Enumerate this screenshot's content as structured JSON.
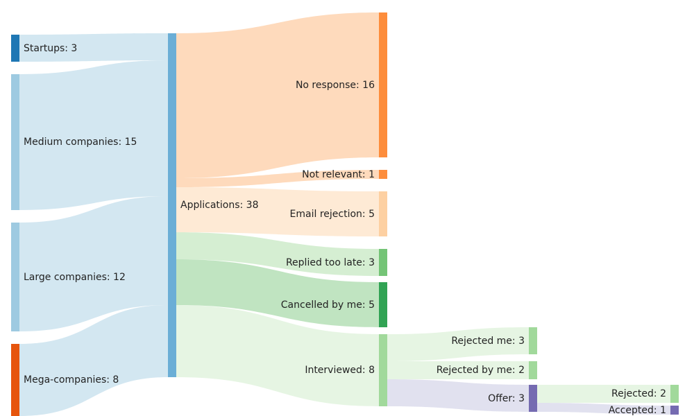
{
  "chart_data": {
    "type": "sankey",
    "title": "",
    "nodes": [
      {
        "id": "startups",
        "label": "Startups: 3",
        "value": 3,
        "color": "#1f77b4"
      },
      {
        "id": "medium",
        "label": "Medium companies: 15",
        "value": 15,
        "color": "#9ecae1"
      },
      {
        "id": "large",
        "label": "Large companies: 12",
        "value": 12,
        "color": "#9ecae1"
      },
      {
        "id": "mega",
        "label": "Mega-companies: 8",
        "value": 8,
        "color": "#e6550d"
      },
      {
        "id": "applications",
        "label": "Applications: 38",
        "value": 38,
        "color": "#6baed6"
      },
      {
        "id": "no_response",
        "label": "No response: 16",
        "value": 16,
        "color": "#fd8d3c"
      },
      {
        "id": "not_relevant",
        "label": "Not relevant: 1",
        "value": 1,
        "color": "#fd8d3c"
      },
      {
        "id": "email_rejection",
        "label": "Email rejection: 5",
        "value": 5,
        "color": "#fdd0a2"
      },
      {
        "id": "replied_late",
        "label": "Replied too late: 3",
        "value": 3,
        "color": "#74c476"
      },
      {
        "id": "cancelled",
        "label": "Cancelled by me: 5",
        "value": 5,
        "color": "#31a354"
      },
      {
        "id": "interviewed",
        "label": "Interviewed: 8",
        "value": 8,
        "color": "#a1d99b"
      },
      {
        "id": "rejected_me",
        "label": "Rejected me: 3",
        "value": 3,
        "color": "#a1d99b"
      },
      {
        "id": "rejected_by_me",
        "label": "Rejected by me: 2",
        "value": 2,
        "color": "#a1d99b"
      },
      {
        "id": "offer",
        "label": "Offer: 3",
        "value": 3,
        "color": "#756bb1"
      },
      {
        "id": "rejected",
        "label": "Rejected: 2",
        "value": 2,
        "color": "#a1d99b"
      },
      {
        "id": "accepted",
        "label": "Accepted: 1",
        "value": 1,
        "color": "#756bb1"
      }
    ],
    "links": [
      {
        "source": "startups",
        "target": "applications",
        "value": 3
      },
      {
        "source": "medium",
        "target": "applications",
        "value": 15
      },
      {
        "source": "large",
        "target": "applications",
        "value": 12
      },
      {
        "source": "mega",
        "target": "applications",
        "value": 8
      },
      {
        "source": "applications",
        "target": "no_response",
        "value": 16
      },
      {
        "source": "applications",
        "target": "not_relevant",
        "value": 1
      },
      {
        "source": "applications",
        "target": "email_rejection",
        "value": 5
      },
      {
        "source": "applications",
        "target": "replied_late",
        "value": 3
      },
      {
        "source": "applications",
        "target": "cancelled",
        "value": 5
      },
      {
        "source": "applications",
        "target": "interviewed",
        "value": 8
      },
      {
        "source": "interviewed",
        "target": "rejected_me",
        "value": 3
      },
      {
        "source": "interviewed",
        "target": "rejected_by_me",
        "value": 2
      },
      {
        "source": "interviewed",
        "target": "offer",
        "value": 3
      },
      {
        "source": "offer",
        "target": "rejected",
        "value": 2
      },
      {
        "source": "offer",
        "target": "accepted",
        "value": 1
      }
    ]
  },
  "colors": {
    "blue_dark": "#1f77b4",
    "blue_light": "#9ecae1",
    "blue_mid": "#6baed6",
    "orange_dark": "#e6550d",
    "orange_mid": "#fd8d3c",
    "orange_pale": "#fdd0a2",
    "green_mid": "#74c476",
    "green_dark": "#31a354",
    "green_light": "#a1d99b",
    "purple": "#756bb1"
  },
  "labels": {
    "startups": "Startups: 3",
    "medium": "Medium companies: 15",
    "large": "Large companies: 12",
    "mega": "Mega-companies: 8",
    "applications": "Applications: 38",
    "no_response": "No response: 16",
    "not_relevant": "Not relevant: 1",
    "email_rejection": "Email rejection: 5",
    "replied_late": "Replied too late: 3",
    "cancelled": "Cancelled by me: 5",
    "interviewed": "Interviewed: 8",
    "rejected_me": "Rejected me: 3",
    "rejected_by_me": "Rejected by me: 2",
    "offer": "Offer: 3",
    "rejected": "Rejected: 2",
    "accepted": "Accepted: 1"
  }
}
